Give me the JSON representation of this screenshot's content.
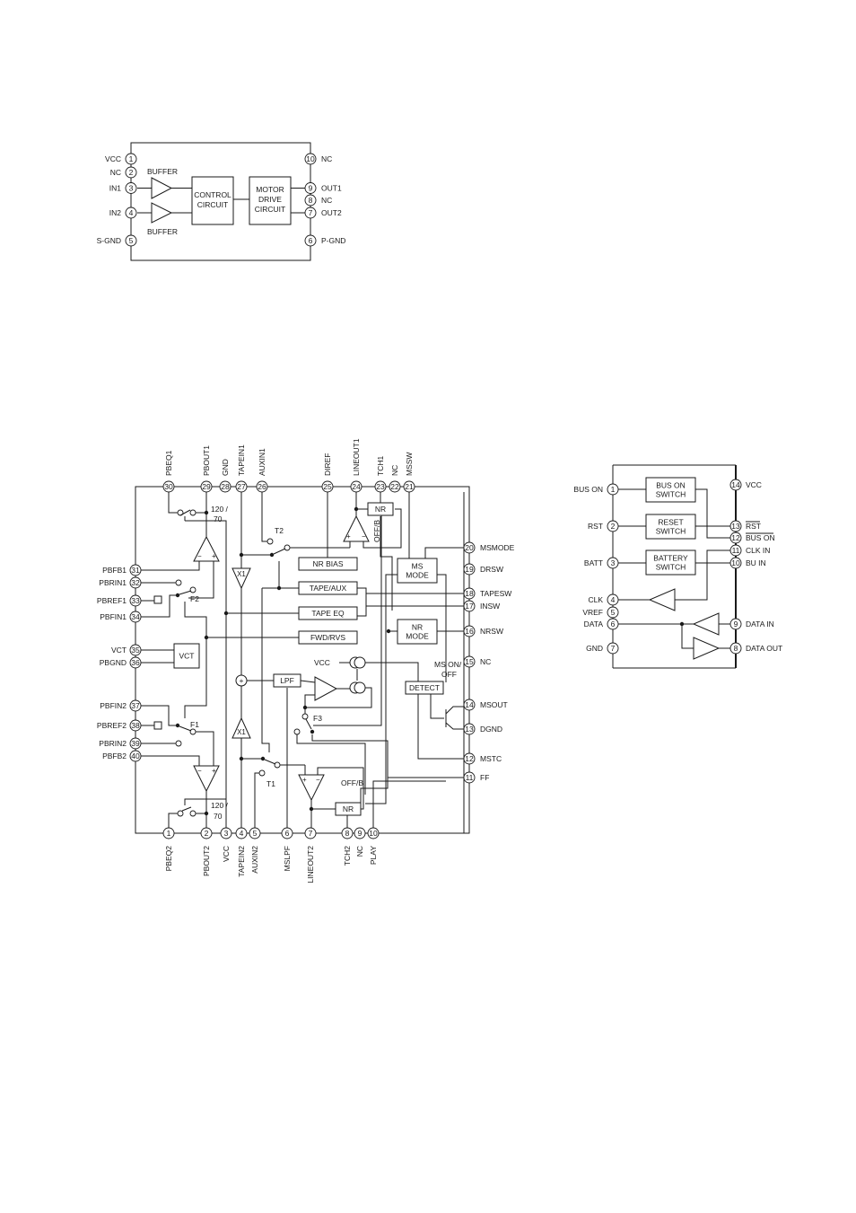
{
  "diagram1": {
    "left_pins": [
      {
        "num": "1",
        "name": "VCC"
      },
      {
        "num": "2",
        "name": "NC"
      },
      {
        "num": "3",
        "name": "IN1"
      },
      {
        "num": "4",
        "name": "IN2"
      },
      {
        "num": "5",
        "name": "S-GND"
      }
    ],
    "right_pins": [
      {
        "num": "10",
        "name": "NC"
      },
      {
        "num": "9",
        "name": "OUT1"
      },
      {
        "num": "8",
        "name": "NC"
      },
      {
        "num": "7",
        "name": "OUT2"
      },
      {
        "num": "6",
        "name": "P-GND"
      }
    ],
    "buffer_top": "BUFFER",
    "buffer_bottom": "BUFFER",
    "control_line1": "CONTROL",
    "control_line2": "CIRCUIT",
    "motor_line1": "MOTOR",
    "motor_line2": "DRIVE",
    "motor_line3": "CIRCUIT"
  },
  "diagram2": {
    "top_pins": [
      {
        "num": "30",
        "name": "PBEQ1"
      },
      {
        "num": "29",
        "name": "PBOUT1"
      },
      {
        "num": "28",
        "name": "GND"
      },
      {
        "num": "27",
        "name": "TAPEIN1"
      },
      {
        "num": "26",
        "name": "AUXIN1"
      },
      {
        "num": "25",
        "name": "DIREF"
      },
      {
        "num": "24",
        "name": "LINEOUT1"
      },
      {
        "num": "23",
        "name": "TCH1"
      },
      {
        "num": "22",
        "name": "NC"
      },
      {
        "num": "21",
        "name": "MSSW"
      }
    ],
    "left_pins": [
      {
        "num": "31",
        "name": "PBFB1"
      },
      {
        "num": "32",
        "name": "PBRIN1"
      },
      {
        "num": "33",
        "name": "PBREF1"
      },
      {
        "num": "34",
        "name": "PBFIN1"
      },
      {
        "num": "35",
        "name": "VCT"
      },
      {
        "num": "36",
        "name": "PBGND"
      },
      {
        "num": "37",
        "name": "PBFIN2"
      },
      {
        "num": "38",
        "name": "PBREF2"
      },
      {
        "num": "39",
        "name": "PBRIN2"
      },
      {
        "num": "40",
        "name": "PBFB2"
      }
    ],
    "right_pins": [
      {
        "num": "20",
        "name": "MSMODE"
      },
      {
        "num": "19",
        "name": "DRSW"
      },
      {
        "num": "18",
        "name": "TAPESW"
      },
      {
        "num": "17",
        "name": "INSW"
      },
      {
        "num": "16",
        "name": "NRSW"
      },
      {
        "num": "15",
        "name": "NC"
      },
      {
        "num": "14",
        "name": "MSOUT"
      },
      {
        "num": "13",
        "name": "DGND"
      },
      {
        "num": "12",
        "name": "MSTC"
      },
      {
        "num": "11",
        "name": "FF"
      }
    ],
    "bottom_pins": [
      {
        "num": "1",
        "name": "PBEQ2"
      },
      {
        "num": "2",
        "name": "PBOUT2"
      },
      {
        "num": "3",
        "name": "VCC"
      },
      {
        "num": "4",
        "name": "TAPEIN2"
      },
      {
        "num": "5",
        "name": "AUXIN2"
      },
      {
        "num": "6",
        "name": "MSLPF"
      },
      {
        "num": "7",
        "name": "LINEOUT2"
      },
      {
        "num": "8",
        "name": "TCH2"
      },
      {
        "num": "9",
        "name": "NC"
      },
      {
        "num": "10",
        "name": "PLAY"
      }
    ],
    "blocks": {
      "nr_bias": "NR BIAS",
      "tape_aux": "TAPE/AUX",
      "tape_eq": "TAPE EQ",
      "fwd_rvs": "FWD/RVS",
      "ms_mode_1": "MS",
      "ms_mode_2": "MODE",
      "nr_mode_1": "NR",
      "nr_mode_2": "MODE",
      "nr_top": "NR",
      "nr_bottom": "NR",
      "vct": "VCT",
      "lpf": "LPF",
      "detect": "DETECT",
      "x1_top": "X1",
      "x1_bottom": "X1",
      "sum": "+"
    },
    "labels": {
      "eq_top_1": "120  /",
      "eq_top_2": "70",
      "eq_bottom_1": "120  /",
      "eq_bottom_2": "70",
      "t2": "T2",
      "t1": "T1",
      "f1": "F1",
      "f2": "F2",
      "f3": "F3",
      "offb_top": "OFF/B",
      "offb_bottom": "OFF/B",
      "vcc": "VCC",
      "ms_onoff_1": "MS ON/",
      "ms_onoff_2": "OFF"
    }
  },
  "diagram3": {
    "left_pins": [
      {
        "num": "1",
        "name": "BUS ON"
      },
      {
        "num": "2",
        "name": "RST"
      },
      {
        "num": "3",
        "name": "BATT"
      },
      {
        "num": "4",
        "name": "CLK"
      },
      {
        "num": "5",
        "name": "VREF"
      },
      {
        "num": "6",
        "name": "DATA"
      },
      {
        "num": "7",
        "name": "GND"
      }
    ],
    "right_pins": [
      {
        "num": "14",
        "name": "VCC"
      },
      {
        "num": "13",
        "name": "RST"
      },
      {
        "num": "12",
        "name": "BUS ON"
      },
      {
        "num": "11",
        "name": "CLK IN"
      },
      {
        "num": "10",
        "name": "BU IN"
      },
      {
        "num": "9",
        "name": "DATA IN"
      },
      {
        "num": "8",
        "name": "DATA OUT"
      }
    ],
    "bus_on_switch_1": "BUS ON",
    "bus_on_switch_2": "SWITCH",
    "reset_switch_1": "RESET",
    "reset_switch_2": "SWITCH",
    "battery_switch_1": "BATTERY",
    "battery_switch_2": "SWITCH"
  }
}
